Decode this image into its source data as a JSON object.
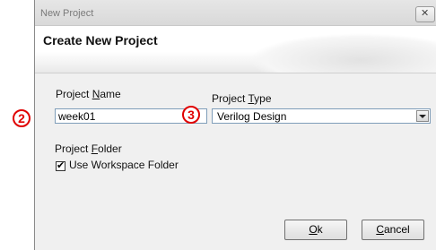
{
  "window": {
    "title": "New Project",
    "close_glyph": "✕"
  },
  "header": {
    "title": "Create New Project"
  },
  "fields": {
    "project_name": {
      "label_pre": "Project ",
      "label_accel": "N",
      "label_post": "ame",
      "value": "week01"
    },
    "project_type": {
      "label_pre": "Project ",
      "label_accel": "T",
      "label_post": "ype",
      "value": "Verilog Design"
    },
    "project_folder": {
      "label_pre": "Project ",
      "label_accel": "F",
      "label_post": "older"
    },
    "use_workspace": {
      "label": "Use Workspace Folder",
      "checked": true,
      "check_glyph": "✔"
    }
  },
  "buttons": {
    "ok": {
      "accel": "O",
      "rest": "k"
    },
    "cancel": {
      "accel": "C",
      "rest": "ancel"
    }
  },
  "annotations": {
    "name_marker": "2",
    "type_marker": "3",
    "color": "#e00000"
  }
}
